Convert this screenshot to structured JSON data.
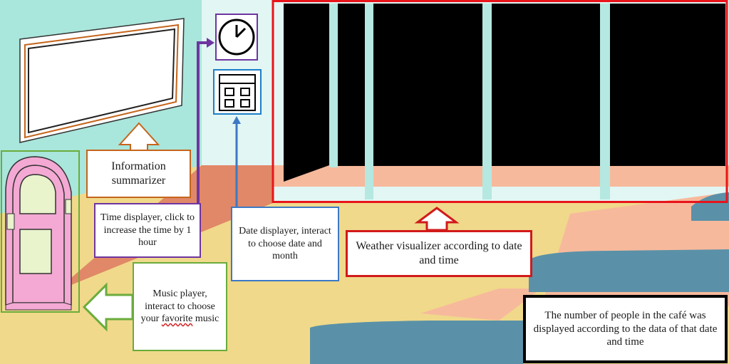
{
  "labels": {
    "info": "Information summarizer",
    "time": "Time displayer, click to increase the time by 1 hour",
    "date": "Date displayer, interact to choose date and month",
    "weather": "Weather visualizer according to date and time",
    "music_before": "Music player, interact to choose your ",
    "music_wavy": "favorite",
    "music_after": " music",
    "people": "The number of people in the café was displayed according to the data of that date and time"
  },
  "icons": {
    "clock": "clock-icon",
    "calendar": "calendar-icon",
    "jukebox": "jukebox-icon",
    "board": "info-board-icon"
  },
  "colors": {
    "info": "#c5651c",
    "time": "#6e35a0",
    "date": "#3d79c4",
    "weather": "#d11a1a",
    "music": "#6aac3c",
    "people": "#000000"
  }
}
